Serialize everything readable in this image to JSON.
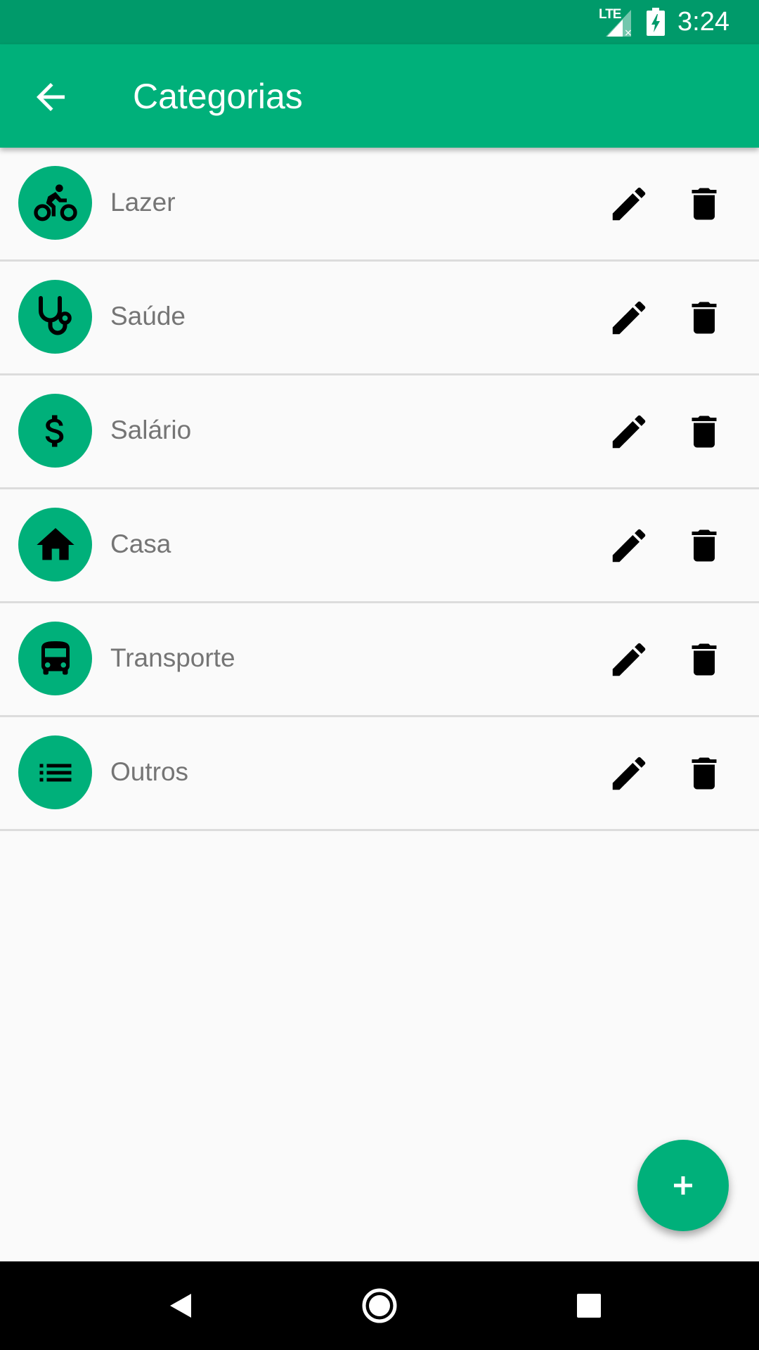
{
  "status_bar": {
    "network": "LTE",
    "time": "3:24"
  },
  "app_bar": {
    "title": "Categorias",
    "back_icon": "arrow-back-icon"
  },
  "categories": [
    {
      "label": "Lazer",
      "icon": "bike-icon"
    },
    {
      "label": "Saúde",
      "icon": "stethoscope-icon"
    },
    {
      "label": "Salário",
      "icon": "dollar-icon"
    },
    {
      "label": "Casa",
      "icon": "home-icon"
    },
    {
      "label": "Transporte",
      "icon": "bus-icon"
    },
    {
      "label": "Outros",
      "icon": "list-icon"
    }
  ],
  "fab": {
    "label": "+"
  },
  "colors": {
    "primary": "#00B07A",
    "primary_dark": "#009A6A",
    "icon": "#000000",
    "text": "#757575"
  }
}
